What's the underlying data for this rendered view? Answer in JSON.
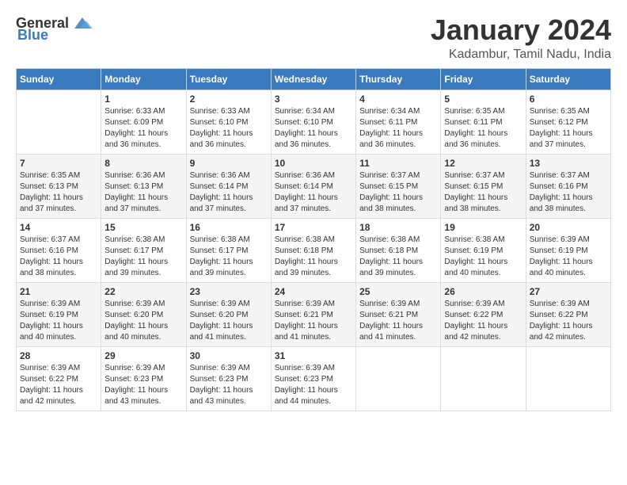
{
  "header": {
    "logo_general": "General",
    "logo_blue": "Blue",
    "title": "January 2024",
    "subtitle": "Kadambur, Tamil Nadu, India"
  },
  "calendar": {
    "days_of_week": [
      "Sunday",
      "Monday",
      "Tuesday",
      "Wednesday",
      "Thursday",
      "Friday",
      "Saturday"
    ],
    "weeks": [
      [
        {
          "day": "",
          "info": ""
        },
        {
          "day": "1",
          "info": "Sunrise: 6:33 AM\nSunset: 6:09 PM\nDaylight: 11 hours\nand 36 minutes."
        },
        {
          "day": "2",
          "info": "Sunrise: 6:33 AM\nSunset: 6:10 PM\nDaylight: 11 hours\nand 36 minutes."
        },
        {
          "day": "3",
          "info": "Sunrise: 6:34 AM\nSunset: 6:10 PM\nDaylight: 11 hours\nand 36 minutes."
        },
        {
          "day": "4",
          "info": "Sunrise: 6:34 AM\nSunset: 6:11 PM\nDaylight: 11 hours\nand 36 minutes."
        },
        {
          "day": "5",
          "info": "Sunrise: 6:35 AM\nSunset: 6:11 PM\nDaylight: 11 hours\nand 36 minutes."
        },
        {
          "day": "6",
          "info": "Sunrise: 6:35 AM\nSunset: 6:12 PM\nDaylight: 11 hours\nand 37 minutes."
        }
      ],
      [
        {
          "day": "7",
          "info": "Sunrise: 6:35 AM\nSunset: 6:13 PM\nDaylight: 11 hours\nand 37 minutes."
        },
        {
          "day": "8",
          "info": "Sunrise: 6:36 AM\nSunset: 6:13 PM\nDaylight: 11 hours\nand 37 minutes."
        },
        {
          "day": "9",
          "info": "Sunrise: 6:36 AM\nSunset: 6:14 PM\nDaylight: 11 hours\nand 37 minutes."
        },
        {
          "day": "10",
          "info": "Sunrise: 6:36 AM\nSunset: 6:14 PM\nDaylight: 11 hours\nand 37 minutes."
        },
        {
          "day": "11",
          "info": "Sunrise: 6:37 AM\nSunset: 6:15 PM\nDaylight: 11 hours\nand 38 minutes."
        },
        {
          "day": "12",
          "info": "Sunrise: 6:37 AM\nSunset: 6:15 PM\nDaylight: 11 hours\nand 38 minutes."
        },
        {
          "day": "13",
          "info": "Sunrise: 6:37 AM\nSunset: 6:16 PM\nDaylight: 11 hours\nand 38 minutes."
        }
      ],
      [
        {
          "day": "14",
          "info": "Sunrise: 6:37 AM\nSunset: 6:16 PM\nDaylight: 11 hours\nand 38 minutes."
        },
        {
          "day": "15",
          "info": "Sunrise: 6:38 AM\nSunset: 6:17 PM\nDaylight: 11 hours\nand 39 minutes."
        },
        {
          "day": "16",
          "info": "Sunrise: 6:38 AM\nSunset: 6:17 PM\nDaylight: 11 hours\nand 39 minutes."
        },
        {
          "day": "17",
          "info": "Sunrise: 6:38 AM\nSunset: 6:18 PM\nDaylight: 11 hours\nand 39 minutes."
        },
        {
          "day": "18",
          "info": "Sunrise: 6:38 AM\nSunset: 6:18 PM\nDaylight: 11 hours\nand 39 minutes."
        },
        {
          "day": "19",
          "info": "Sunrise: 6:38 AM\nSunset: 6:19 PM\nDaylight: 11 hours\nand 40 minutes."
        },
        {
          "day": "20",
          "info": "Sunrise: 6:39 AM\nSunset: 6:19 PM\nDaylight: 11 hours\nand 40 minutes."
        }
      ],
      [
        {
          "day": "21",
          "info": "Sunrise: 6:39 AM\nSunset: 6:19 PM\nDaylight: 11 hours\nand 40 minutes."
        },
        {
          "day": "22",
          "info": "Sunrise: 6:39 AM\nSunset: 6:20 PM\nDaylight: 11 hours\nand 40 minutes."
        },
        {
          "day": "23",
          "info": "Sunrise: 6:39 AM\nSunset: 6:20 PM\nDaylight: 11 hours\nand 41 minutes."
        },
        {
          "day": "24",
          "info": "Sunrise: 6:39 AM\nSunset: 6:21 PM\nDaylight: 11 hours\nand 41 minutes."
        },
        {
          "day": "25",
          "info": "Sunrise: 6:39 AM\nSunset: 6:21 PM\nDaylight: 11 hours\nand 41 minutes."
        },
        {
          "day": "26",
          "info": "Sunrise: 6:39 AM\nSunset: 6:22 PM\nDaylight: 11 hours\nand 42 minutes."
        },
        {
          "day": "27",
          "info": "Sunrise: 6:39 AM\nSunset: 6:22 PM\nDaylight: 11 hours\nand 42 minutes."
        }
      ],
      [
        {
          "day": "28",
          "info": "Sunrise: 6:39 AM\nSunset: 6:22 PM\nDaylight: 11 hours\nand 42 minutes."
        },
        {
          "day": "29",
          "info": "Sunrise: 6:39 AM\nSunset: 6:23 PM\nDaylight: 11 hours\nand 43 minutes."
        },
        {
          "day": "30",
          "info": "Sunrise: 6:39 AM\nSunset: 6:23 PM\nDaylight: 11 hours\nand 43 minutes."
        },
        {
          "day": "31",
          "info": "Sunrise: 6:39 AM\nSunset: 6:23 PM\nDaylight: 11 hours\nand 44 minutes."
        },
        {
          "day": "",
          "info": ""
        },
        {
          "day": "",
          "info": ""
        },
        {
          "day": "",
          "info": ""
        }
      ]
    ]
  }
}
